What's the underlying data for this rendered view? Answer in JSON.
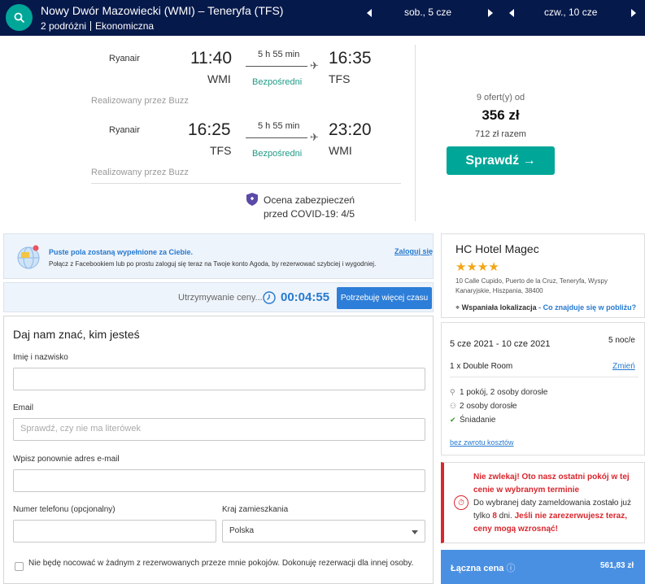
{
  "topbar": {
    "route": "Nowy Dwór Mazowiecki (WMI) – Teneryfa (TFS)",
    "travellers": "2 podróżni",
    "cabin": "Ekonomiczna",
    "depart_date": "sob., 5 cze",
    "return_date": "czw., 10 cze"
  },
  "flight": {
    "outbound": {
      "airline": "Ryanair",
      "dep_time": "11:40",
      "dep_code": "WMI",
      "duration": "5 h 55 min",
      "stops": "Bezpośredni",
      "arr_time": "16:35",
      "arr_code": "TFS",
      "operated": "Realizowany przez Buzz"
    },
    "inbound": {
      "airline": "Ryanair",
      "dep_time": "16:25",
      "dep_code": "TFS",
      "duration": "5 h 55 min",
      "stops": "Bezpośredni",
      "arr_time": "23:20",
      "arr_code": "WMI",
      "operated": "Realizowany przez Buzz"
    },
    "covid_line1": "Ocena zabezpieczeń",
    "covid_line2": "przed COVID-19: 4/5",
    "offers": "9 ofert(y) od",
    "price": "356 zł",
    "price_total": "712 zł razem",
    "check_label": "Sprawdź →"
  },
  "facebook": {
    "title": "Puste pola zostaną wypełnione za Ciebie.",
    "subtitle": "Połącz z Facebookiem lub po prostu zaloguj się teraz na Twoje konto Agoda, by rezerwować szybciej i wygodniej.",
    "login": "Zaloguj się"
  },
  "hold": {
    "label": "Utrzymywanie ceny...",
    "timer": "00:04:55",
    "more_time": "Potrzebuję więcej czasu"
  },
  "form": {
    "title": "Daj nam znać, kim jesteś",
    "name_label": "Imię i nazwisko",
    "name_value": "",
    "email_label": "Email",
    "email_placeholder": "Sprawdź, czy nie ma literówek",
    "email_repeat_label": "Wpisz ponownie adres e-mail",
    "phone_label": "Numer telefonu (opcjonalny)",
    "country_label": "Kraj zamieszkania",
    "country_value": "Polska",
    "no_stay_label": "Nie będę nocować w żadnym z rezerwowanych przeze mnie pokojów. Dokonuję rezerwacji dla innej osoby."
  },
  "hotel": {
    "name": "HC Hotel Magec",
    "stars": "★★★★",
    "address": "10 Calle Cupido, Puerto de la Cruz, Teneryfa, Wyspy Kanaryjskie, Hiszpania, 38400",
    "location_label": "Wspaniała lokalizacja",
    "location_link": "- Co znajduje się w pobliżu?"
  },
  "stay": {
    "dates": "5 cze 2021 - 10 cze 2021",
    "nights": "5 noc/e",
    "room": "1 x Double Room",
    "change": "Zmień",
    "feature1": "1 pokój, 2 osoby dorosłe",
    "feature2": "2 osoby dorosłe",
    "feature3": "Śniadanie",
    "refund": "bez zwrotu kosztów"
  },
  "alert": {
    "line1": "Nie zwlekaj! Oto nasz ostatni pokój w tej cenie w wybranym terminie",
    "line2a": "Do wybranej daty zameldowania zostało już tylko ",
    "days": "8",
    "line2b": " dni. ",
    "line3": "Jeśli nie zarezerwujesz teraz, ceny mogą wzrosnąć!"
  },
  "total": {
    "label": "Łączna cena",
    "info_icon": "ⓘ",
    "value": "561,83 zł"
  }
}
